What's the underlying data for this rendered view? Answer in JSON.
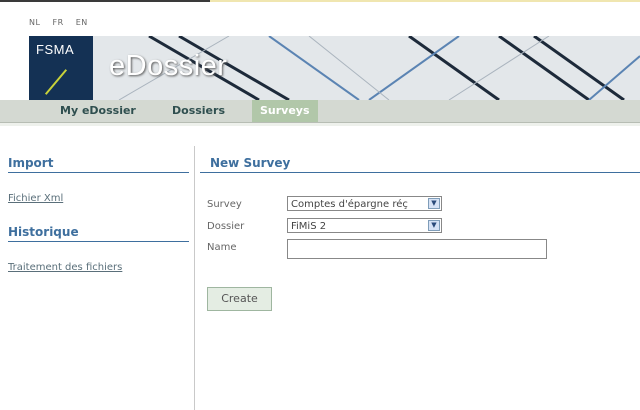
{
  "languages": [
    "NL",
    "FR",
    "EN"
  ],
  "brand": {
    "logo_text": "FSMA",
    "app_title": "eDossier"
  },
  "nav": {
    "items": [
      {
        "label": "My eDossier",
        "active": false
      },
      {
        "label": "Dossiers",
        "active": false
      },
      {
        "label": "Surveys",
        "active": true
      }
    ]
  },
  "sidebar": {
    "import": {
      "title": "Import",
      "links": [
        "Fichier Xml"
      ]
    },
    "history": {
      "title": "Historique",
      "links": [
        "Traitement des fichiers"
      ]
    }
  },
  "main": {
    "title": "New Survey",
    "fields": {
      "survey": {
        "label": "Survey",
        "value": "Comptes d'épargne réç"
      },
      "dossier": {
        "label": "Dossier",
        "value": "FiMiS 2"
      },
      "name": {
        "label": "Name",
        "value": ""
      }
    },
    "create_label": "Create"
  },
  "colors": {
    "logo_bg": "#143154",
    "accent": "#3e6f9e",
    "nav_active": "#b1c7a9"
  }
}
